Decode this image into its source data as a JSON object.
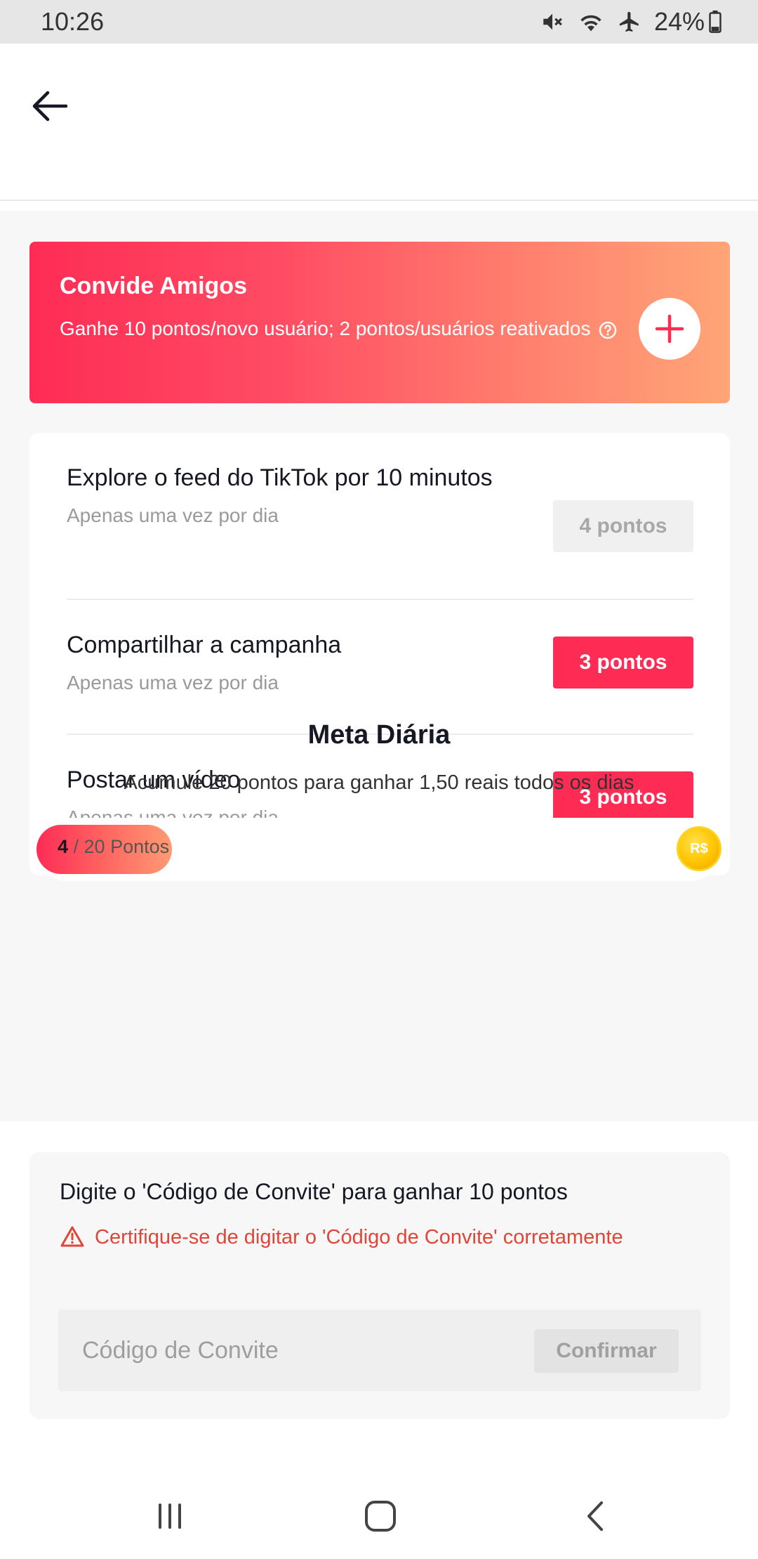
{
  "status_bar": {
    "time": "10:26",
    "battery": "24%",
    "icons": [
      "mute-icon",
      "wifi-icon",
      "airplane-icon",
      "battery-icon"
    ]
  },
  "header": {
    "back_icon": "arrow-left-icon"
  },
  "invite": {
    "title": "Convide Amigos",
    "description": "Ganhe 10 pontos/novo usuário; 2 pontos/usuários reativados",
    "action_icon": "plus-icon"
  },
  "tasks": [
    {
      "title": "Explore o feed do TikTok por 10 minutos",
      "subtitle": "Apenas uma vez por dia",
      "points": "4 pontos",
      "state": "disabled"
    },
    {
      "title": "Compartilhar a campanha",
      "subtitle": "Apenas uma vez por dia",
      "points": "3 pontos",
      "state": "active"
    },
    {
      "title": "Postar um vídeo",
      "subtitle": "Apenas uma vez por dia",
      "points": "3 pontos",
      "state": "active"
    }
  ],
  "daily_goal": {
    "title": "Meta Diária",
    "subtitle": "Acumule 20 pontos para ganhar 1,50 reais todos os dias",
    "current": "4",
    "total_label": " / 20 Pontos",
    "progress_fraction": 0.2,
    "coin_label": "R$"
  },
  "invite_code": {
    "title": "Digite o 'Código de Convite' para ganhar 10 pontos",
    "warning": "Certifique-se de digitar o 'Código de Convite' corretamente",
    "placeholder": "Código de Convite",
    "confirm_label": "Confirmar"
  },
  "colors": {
    "brand": "#fe2c55",
    "warning": "#e0453a"
  }
}
